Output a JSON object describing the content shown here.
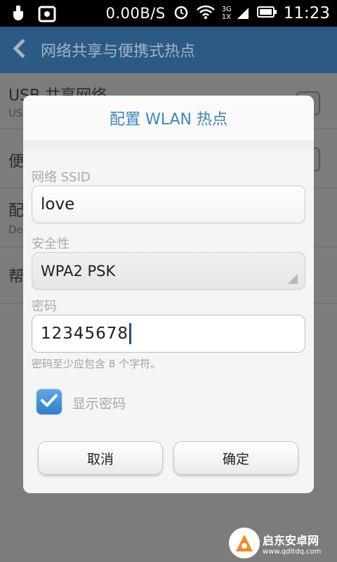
{
  "status_bar": {
    "speed": "0.00B/S",
    "network": "3G 1X",
    "time": "11:23"
  },
  "action_bar": {
    "title": "网络共享与便携式热点"
  },
  "background_list": {
    "items": [
      {
        "title": "USB 共享网络",
        "subtitle": "US"
      },
      {
        "title": "便"
      },
      {
        "title": "配",
        "subtitle": "De"
      },
      {
        "title": "帮"
      }
    ]
  },
  "dialog": {
    "title": "配置 WLAN 热点",
    "ssid_label": "网络 SSID",
    "ssid_value": "love",
    "security_label": "安全性",
    "security_value": "WPA2 PSK",
    "password_label": "密码",
    "password_value": "12345678",
    "password_hint": "密码至少应包含 8 个字符。",
    "show_password_label": "显示密码",
    "show_password_checked": true,
    "cancel_label": "取消",
    "confirm_label": "确定"
  },
  "watermark": {
    "name": "启东安卓网",
    "domain": "www.qdltdq.com"
  },
  "colors": {
    "action_bar": "#2b5a84",
    "dialog_title": "#3d86bd",
    "checkbox": "#3b8ad0"
  }
}
